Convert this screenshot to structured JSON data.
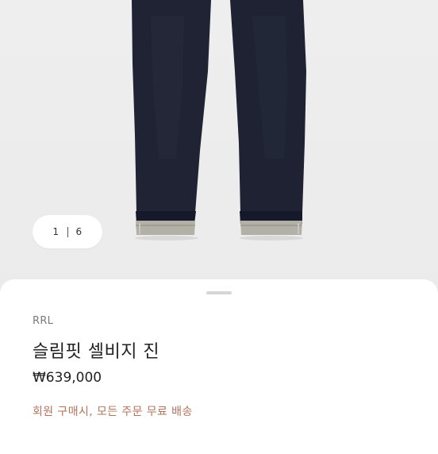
{
  "pager": {
    "current": "1",
    "total": "6"
  },
  "product": {
    "brand": "RRL",
    "name": "슬림핏 셀비지 진",
    "price": "₩639,000",
    "promo": "회원 구매시, 모든 주문 무료 배송"
  },
  "image": {
    "subject": "jeans-photo",
    "denim_color": "#1f2333",
    "cuff_color": "#b3b0a7"
  }
}
